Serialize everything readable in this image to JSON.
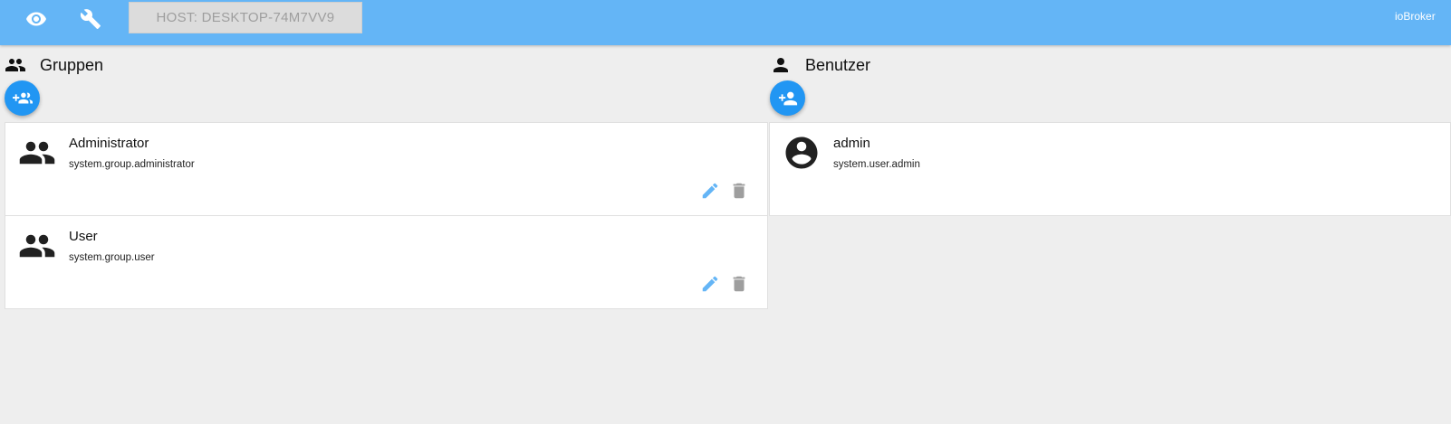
{
  "topbar": {
    "view_icon": "eye-icon",
    "settings_icon": "wrench-icon",
    "host_label": "HOST: DESKTOP-74M7VV9",
    "brand": "ioBroker",
    "color": "#64b5f6"
  },
  "groups": {
    "title": "Gruppen",
    "header_icon": "group-icon",
    "add_icon": "group-add-icon",
    "items": [
      {
        "name": "Administrator",
        "id": "system.group.administrator"
      },
      {
        "name": "User",
        "id": "system.group.user"
      }
    ]
  },
  "users": {
    "title": "Benutzer",
    "header_icon": "person-icon",
    "add_icon": "person-add-icon",
    "items": [
      {
        "name": "admin",
        "id": "system.user.admin"
      }
    ]
  },
  "colors": {
    "fab": "#2196f3",
    "edit": "#64b5f6",
    "delete": "#9e9e9e",
    "background": "#eeeeee"
  }
}
